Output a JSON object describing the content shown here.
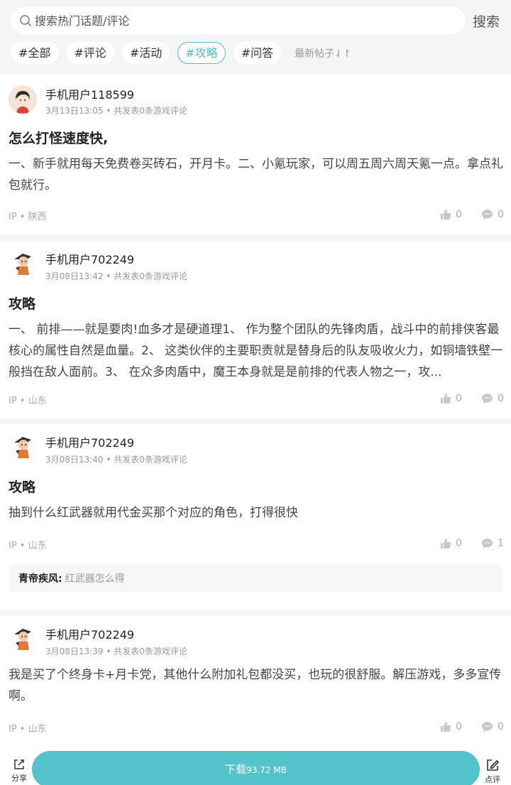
{
  "search": {
    "placeholder": "搜索热门话题/评论",
    "button_label": "搜索"
  },
  "tabs": [
    {
      "label": "#全部",
      "active": false
    },
    {
      "label": "#评论",
      "active": false
    },
    {
      "label": "#活动",
      "active": false
    },
    {
      "label": "#攻略",
      "active": true
    },
    {
      "label": "#问答",
      "active": false
    }
  ],
  "sort_label": "最新帖子⇃↾",
  "posts": [
    {
      "username": "手机用户118599",
      "date": "3月13日13:05",
      "meta_suffix": "• 共发表0条游戏评论",
      "title": "怎么打怪速度快,",
      "content": "一、新手就用每天免费卷买砖石，开月卡。二、小氪玩家，可以周五周六周天氪一点。拿点礼包就行。",
      "ip": "IP • 陕西",
      "likes": "0",
      "comments": "0"
    },
    {
      "username": "手机用户702249",
      "date": "3月08日13:42",
      "meta_suffix": "• 共发表0条游戏评论",
      "title": "攻略",
      "content": "一、 前排——就是要肉!血多才是硬道理1、 作为整个团队的先锋肉盾，战斗中的前排侠客最核心的属性自然是血量。2、 这类伙伴的主要职责就是替身后的队友吸收火力，如铜墙铁壁一般挡在敌人面前。3、 在众多肉盾中，魔王本身就是是前排的代表人物之一，攻...",
      "ip": "IP • 山东",
      "likes": "0",
      "comments": "0"
    },
    {
      "username": "手机用户702249",
      "date": "3月08日13:40",
      "meta_suffix": "• 共发表0条游戏评论",
      "title": "攻略",
      "content": "抽到什么红武器就用代金买那个对应的角色，打得很快",
      "ip": "IP • 山东",
      "likes": "0",
      "comments": "1",
      "reply": {
        "user": "青帝疾风:",
        "text": "红武器怎么得"
      }
    },
    {
      "username": "手机用户702249",
      "date": "3月08日13:39",
      "meta_suffix": "• 共发表0条游戏评论",
      "content": "我是买了个终身卡+月卡党，其他什么附加礼包都没买，也玩的很舒服。解压游戏，多多宣传啊。",
      "ip": "IP • 山东",
      "likes": "0",
      "comments": "0"
    }
  ],
  "bottom": {
    "share_label": "分享",
    "download_label": "下载",
    "download_size": "93.72 MB",
    "review_label": "点评"
  },
  "colors": {
    "accent": "#55bcc6",
    "download_bg": "#55c3cb",
    "page_bg": "#f4f5f7"
  }
}
